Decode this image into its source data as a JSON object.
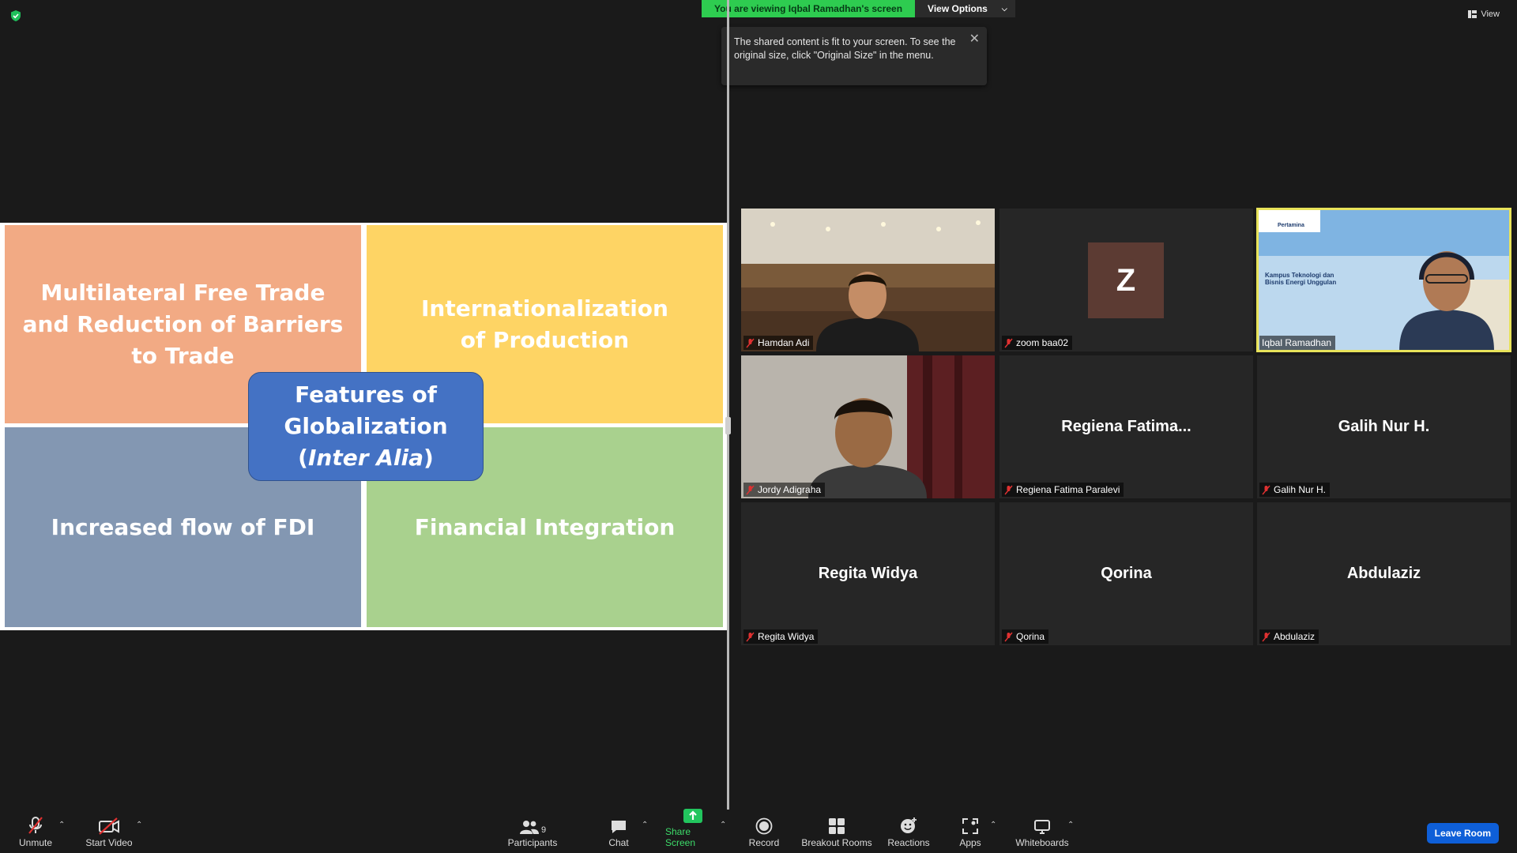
{
  "banner": {
    "viewing": "You are viewing Iqbal Ramadhan's screen",
    "view_options": "View Options"
  },
  "top_right": {
    "view": "View"
  },
  "tooltip": {
    "text": "The shared content is fit to your screen. To see the original size, click \"Original Size\" in the menu."
  },
  "slide": {
    "top_left": "Multilateral Free Trade and Reduction of Barriers to Trade",
    "top_right": "Internationalization of Production",
    "bottom_left": "Increased flow of FDI",
    "bottom_right": "Financial Integration",
    "center_line1": "Features of",
    "center_line2a": "Globalization (",
    "center_italic": "Inter Alia",
    "center_close": ")"
  },
  "participants": [
    {
      "label": "Hamdan Adi",
      "display": "video"
    },
    {
      "label": "zoom baa02",
      "display": "avatar",
      "initial": "Z"
    },
    {
      "label": "Iqbal Ramadhan",
      "display": "video",
      "active": true,
      "slide_text": "Kampus Teknologi dan Bisnis Energi Unggulan",
      "logo_text": "Pertamina"
    },
    {
      "label": "Jordy Adigraha",
      "display": "video"
    },
    {
      "label": "Regiena Fatima Paralevi",
      "display": "name",
      "big": "Regiena  Fatima..."
    },
    {
      "label": "Galih Nur H.",
      "display": "name",
      "big": "Galih Nur H."
    },
    {
      "label": "Regita Widya",
      "display": "name",
      "big": "Regita Widya"
    },
    {
      "label": "Qorina",
      "display": "name",
      "big": "Qorina"
    },
    {
      "label": "Abdulaziz",
      "display": "name",
      "big": "Abdulaziz"
    }
  ],
  "toolbar": {
    "unmute": "Unmute",
    "start_video": "Start Video",
    "participants": "Participants",
    "participants_count": "9",
    "chat": "Chat",
    "share_screen": "Share Screen",
    "record": "Record",
    "breakout_rooms": "Breakout Rooms",
    "reactions": "Reactions",
    "apps": "Apps",
    "whiteboards": "Whiteboards",
    "leave_room": "Leave Room"
  },
  "colors": {
    "share_green": "#22c55e",
    "leave_blue": "#0e5fd8",
    "active_speaker": "#e8e35a"
  }
}
